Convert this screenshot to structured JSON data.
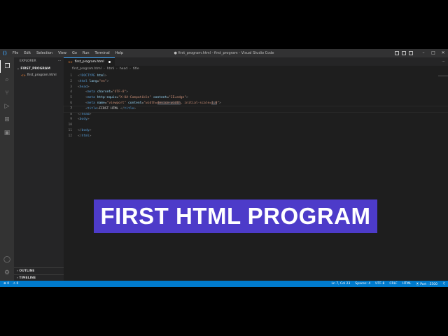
{
  "window": {
    "title": "● first_program.html - first_program - Visual Studio Code",
    "menu": [
      "File",
      "Edit",
      "Selection",
      "View",
      "Go",
      "Run",
      "Terminal",
      "Help"
    ]
  },
  "activity_bar": [
    "explorer-icon",
    "search-icon",
    "source-control-icon",
    "run-debug-icon",
    "extensions-icon",
    "remote-explorer-icon",
    "account-icon",
    "manage-gear-icon"
  ],
  "sidebar": {
    "header": "EXPLORER",
    "folder": "FIRST_PROGRAM",
    "files": [
      "first_program.html"
    ],
    "sections": [
      "OUTLINE",
      "TIMELINE"
    ]
  },
  "editor": {
    "tab_label": "first_program.html",
    "breadcrumb": [
      "first_program.html",
      "html",
      "head",
      "title"
    ],
    "line_numbers": [
      "1",
      "2",
      "3",
      "4",
      "5",
      "6",
      "7",
      "8",
      "9",
      "10",
      "11",
      "12"
    ],
    "current_line": 7
  },
  "status_bar": {
    "left": [
      "⊗ 0",
      "⚠ 0"
    ],
    "right": [
      "Ln 7, Col 23",
      "Spaces: 4",
      "UTF-8",
      "CRLF",
      "HTML",
      "⦿ Port : 5500"
    ]
  },
  "overlay": {
    "text": "FIRST HTML PROGRAM",
    "color": "#4d3bc9"
  }
}
